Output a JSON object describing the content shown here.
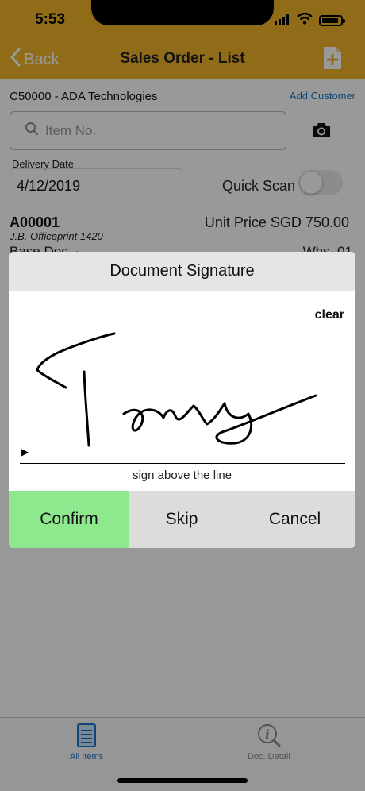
{
  "status_bar": {
    "time": "5:53"
  },
  "nav": {
    "back_label": "Back",
    "title": "Sales Order - List"
  },
  "customer": {
    "name": "C50000 - ADA Technologies",
    "add_label": "Add Customer"
  },
  "search": {
    "placeholder": "Item No."
  },
  "delivery": {
    "label": "Delivery Date",
    "value": "4/12/2019"
  },
  "quick_scan": {
    "label": "Quick Scan",
    "enabled": false
  },
  "item": {
    "code": "A00001",
    "description": "J.B. Officeprint 1420",
    "unit_price": "Unit Price SGD 750.00",
    "base_doc": "Base Doc. -",
    "whs": "Whs. 01"
  },
  "dialog": {
    "title": "Document Signature",
    "clear_label": "clear",
    "hint": "sign above the line",
    "confirm_label": "Confirm",
    "skip_label": "Skip",
    "cancel_label": "Cancel"
  },
  "tabs": [
    {
      "label": "All Items",
      "icon": "list-icon",
      "active": true
    },
    {
      "label": "Doc. Detail",
      "icon": "info-icon",
      "active": false
    }
  ],
  "colors": {
    "nav_bar": "#f0b428",
    "link_blue": "#1a73c8",
    "confirm_green": "#8ee88e"
  }
}
